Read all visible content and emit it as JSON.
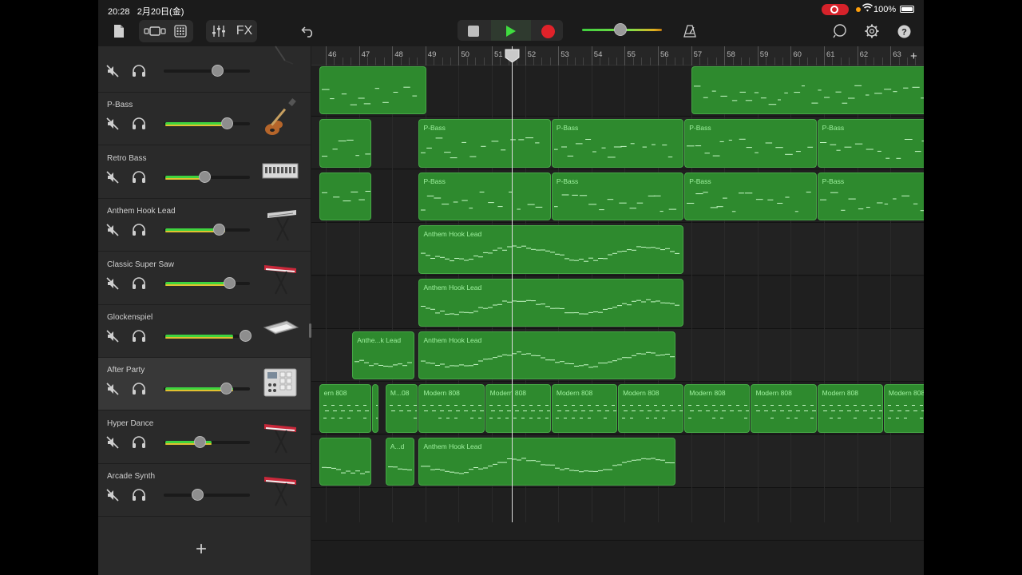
{
  "status_bar": {
    "time": "20:28",
    "date": "2月20日(金)",
    "battery_text": "100%"
  },
  "toolbar": {
    "fx_label": "FX",
    "master_volume": 0.48
  },
  "colors": {
    "region": "#2e8a2e",
    "region_text": "#9ff29f",
    "record": "#e0222a",
    "play": "#3fdc3f",
    "level": "#3fd43f"
  },
  "ruler": {
    "bars": [
      "46",
      "47",
      "48",
      "49",
      "50",
      "51",
      "52",
      "53",
      "54",
      "55",
      "56",
      "57",
      "58",
      "59",
      "60",
      "61",
      "62",
      "63"
    ]
  },
  "tracks": [
    {
      "name": "",
      "muted": true,
      "volume": 0.62,
      "meter": 0,
      "instrument": "guitar-icon"
    },
    {
      "name": "P-Bass",
      "muted": true,
      "volume": 0.73,
      "meter": 0.71,
      "instrument": "bass-guitar-icon"
    },
    {
      "name": "Retro Bass",
      "muted": true,
      "volume": 0.47,
      "meter": 0.45,
      "instrument": "synth-module-icon"
    },
    {
      "name": "Anthem Hook Lead",
      "muted": true,
      "volume": 0.64,
      "meter": 0.72,
      "instrument": "keyboard-stand-icon"
    },
    {
      "name": "Classic Super Saw",
      "muted": true,
      "volume": 0.76,
      "meter": 0.76,
      "instrument": "red-keyboard-icon"
    },
    {
      "name": "Glockenspiel",
      "muted": true,
      "volume": 0.94,
      "meter": 0.82,
      "instrument": "keyboard-icon"
    },
    {
      "name": "After Party",
      "muted": true,
      "volume": 0.72,
      "meter": 0.82,
      "instrument": "drum-machine-icon"
    },
    {
      "name": "Hyper Dance",
      "muted": true,
      "volume": 0.42,
      "meter": 0.56,
      "instrument": "red-keyboard-icon"
    },
    {
      "name": "Arcade Synth",
      "muted": true,
      "volume": 0.39,
      "meter": 0,
      "instrument": "red-keyboard-icon"
    }
  ],
  "regions": [
    {
      "lane": 0,
      "start": 45.8,
      "end": 49.05,
      "name": ""
    },
    {
      "lane": 0,
      "start": 57.0,
      "end": 64.5,
      "name": ""
    },
    {
      "lane": 1,
      "start": 45.8,
      "end": 47.4,
      "name": ""
    },
    {
      "lane": 1,
      "start": 48.8,
      "end": 52.8,
      "name": "P-Bass"
    },
    {
      "lane": 1,
      "start": 52.8,
      "end": 56.8,
      "name": "P-Bass"
    },
    {
      "lane": 1,
      "start": 56.8,
      "end": 60.8,
      "name": "P-Bass"
    },
    {
      "lane": 1,
      "start": 60.8,
      "end": 64.5,
      "name": "P-Bass"
    },
    {
      "lane": 2,
      "start": 45.8,
      "end": 47.4,
      "name": ""
    },
    {
      "lane": 2,
      "start": 48.8,
      "end": 52.8,
      "name": "P-Bass"
    },
    {
      "lane": 2,
      "start": 52.8,
      "end": 56.8,
      "name": "P-Bass"
    },
    {
      "lane": 2,
      "start": 56.8,
      "end": 60.8,
      "name": "P-Bass"
    },
    {
      "lane": 2,
      "start": 60.8,
      "end": 64.5,
      "name": "P-Bass"
    },
    {
      "lane": 3,
      "start": 48.8,
      "end": 56.8,
      "name": "Anthem Hook Lead"
    },
    {
      "lane": 4,
      "start": 48.8,
      "end": 56.8,
      "name": "Anthem Hook Lead"
    },
    {
      "lane": 5,
      "start": 46.8,
      "end": 48.7,
      "name": "Anthe...k Lead"
    },
    {
      "lane": 5,
      "start": 48.8,
      "end": 56.55,
      "name": "Anthem Hook Lead"
    },
    {
      "lane": 6,
      "start": 45.8,
      "end": 47.4,
      "name": "ern 808"
    },
    {
      "lane": 6,
      "start": 47.4,
      "end": 47.62,
      "name": ""
    },
    {
      "lane": 6,
      "start": 47.8,
      "end": 48.8,
      "name": "M...08"
    },
    {
      "lane": 6,
      "start": 48.8,
      "end": 50.8,
      "name": "Modern 808"
    },
    {
      "lane": 6,
      "start": 50.8,
      "end": 52.8,
      "name": "Modern 808"
    },
    {
      "lane": 6,
      "start": 52.8,
      "end": 54.8,
      "name": "Modern 808"
    },
    {
      "lane": 6,
      "start": 54.8,
      "end": 56.8,
      "name": "Modern 808"
    },
    {
      "lane": 6,
      "start": 56.8,
      "end": 58.8,
      "name": "Modern 808"
    },
    {
      "lane": 6,
      "start": 58.8,
      "end": 60.8,
      "name": "Modern 808"
    },
    {
      "lane": 6,
      "start": 60.8,
      "end": 62.8,
      "name": "Modern 808"
    },
    {
      "lane": 6,
      "start": 62.8,
      "end": 64.5,
      "name": "Modern 808"
    },
    {
      "lane": 7,
      "start": 45.8,
      "end": 47.4,
      "name": ""
    },
    {
      "lane": 7,
      "start": 47.8,
      "end": 48.7,
      "name": "A...d"
    },
    {
      "lane": 7,
      "start": 48.8,
      "end": 56.55,
      "name": "Anthem Hook Lead"
    }
  ],
  "playhead_bar": 51.6
}
